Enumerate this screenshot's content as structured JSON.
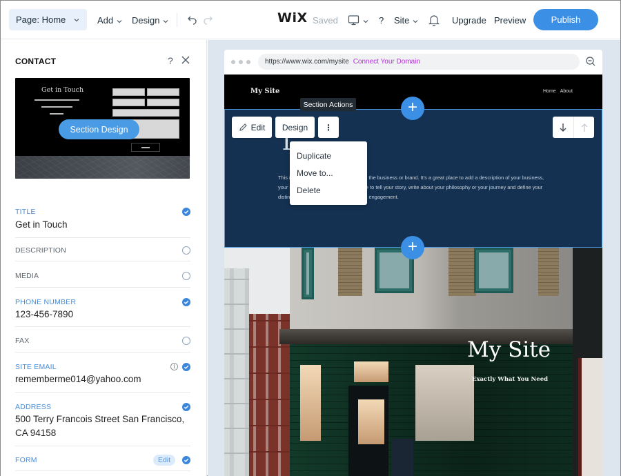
{
  "topbar": {
    "page_select": "Page: Home",
    "add": "Add",
    "design": "Design",
    "logo": "WiX",
    "saved": "Saved",
    "help": "?",
    "site": "Site",
    "upgrade": "Upgrade",
    "preview": "Preview",
    "publish": "Publish"
  },
  "panel": {
    "title": "CONTACT",
    "help": "?",
    "thumbnail": {
      "heading": "Get in Touch",
      "overlay_label": "Section Design"
    },
    "fields": [
      {
        "label": "TITLE",
        "value": "Get in Touch",
        "enabled": true
      },
      {
        "label": "DESCRIPTION",
        "value": "",
        "enabled": false
      },
      {
        "label": "MEDIA",
        "value": "",
        "enabled": false
      },
      {
        "label": "PHONE NUMBER",
        "value": "123-456-7890",
        "enabled": true
      },
      {
        "label": "FAX",
        "value": "",
        "enabled": false
      },
      {
        "label": "SITE EMAIL",
        "value": "rememberme014@yahoo.com",
        "enabled": true,
        "info": "i"
      },
      {
        "label": "ADDRESS",
        "value": "500 Terry Francois Street San Francisco, CA 94158",
        "enabled": true
      },
      {
        "label": "FORM",
        "value": "",
        "enabled": true,
        "action": "Edit"
      }
    ]
  },
  "canvas": {
    "url": "https://www.wix.com/mysite",
    "connect_domain": "Connect Your Domain",
    "site_logo": "My Site",
    "nav": [
      "Home",
      "About"
    ],
    "section_actions_tooltip": "Section Actions",
    "section_title_fragment": "T",
    "section_text": "This is the space to introduce visitors to the business or brand. It's a great place to add a description of your business, your site or what you do. Use this space to tell your story, write about your philosophy or your journey and define your distinguishing qualities to get your extra engagement.",
    "edit_btn": "Edit",
    "design_btn": "Design",
    "more_btn": "⋮",
    "context_menu": [
      "Duplicate",
      "Move to...",
      "Delete"
    ],
    "hero_title": "My Site",
    "hero_subtitle": "Exactly What You Need",
    "add_section": "+"
  },
  "colors": {
    "accent": "#3b8fe4",
    "section_bg": "#143152",
    "connect_domain": "#b32fdb",
    "label_on": "#4a8cd6"
  }
}
